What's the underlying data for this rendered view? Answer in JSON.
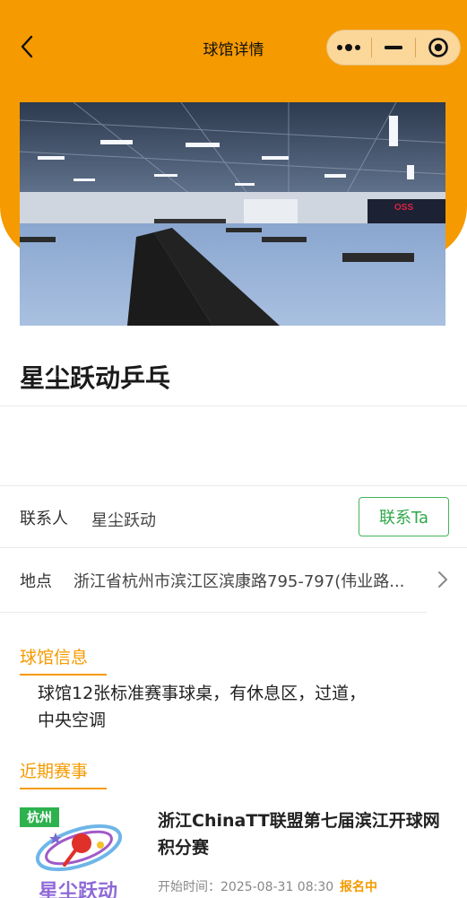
{
  "navbar": {
    "title": "球馆详情"
  },
  "hero": {
    "image_desc_icon": "table-tennis-hall-photo",
    "banner_text": "OSS"
  },
  "venue": {
    "name": "星尘跃动乒乓"
  },
  "contact": {
    "label": "联系人",
    "value": "星尘跃动",
    "button": "联系Ta"
  },
  "address": {
    "label": "地点",
    "value": "浙江省杭州市滨江区滨康路795-797(伟业路..."
  },
  "info": {
    "title": "球馆信息",
    "text": "球馆12张标准赛事球桌，有休息区，过道，中央空调"
  },
  "events": {
    "title": "近期赛事",
    "items": [
      {
        "city": "杭州",
        "title": "浙江ChinaTT联盟第七届滨江开球网积分赛",
        "time": "开始时间：2025-08-31 08:30",
        "status": "报名中",
        "logo_text": "星尘跃动"
      }
    ]
  },
  "colors": {
    "accent": "#f59a00",
    "green": "#2fa84a"
  }
}
